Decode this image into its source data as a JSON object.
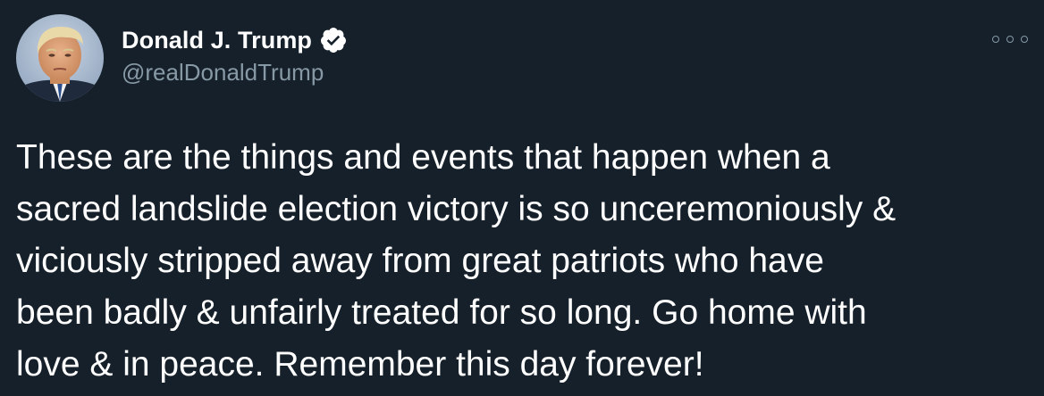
{
  "tweet": {
    "author": {
      "display_name": "Donald J. Trump",
      "handle": "@realDonaldTrump",
      "verified": true,
      "avatar_icon": "profile-photo"
    },
    "menu_icon": "more-options-icon",
    "text_lines": [
      "These are the things and events that happen when a",
      "sacred landslide election victory is so unceremoniously &",
      "viciously stripped away from great patriots who have",
      "been badly & unfairly treated for so long. Go home with",
      "love & in peace. Remember this day forever!"
    ]
  },
  "colors": {
    "background": "#15202b",
    "text": "#ffffff",
    "secondary_text": "#8899a6",
    "verified_badge": "#ffffff"
  }
}
